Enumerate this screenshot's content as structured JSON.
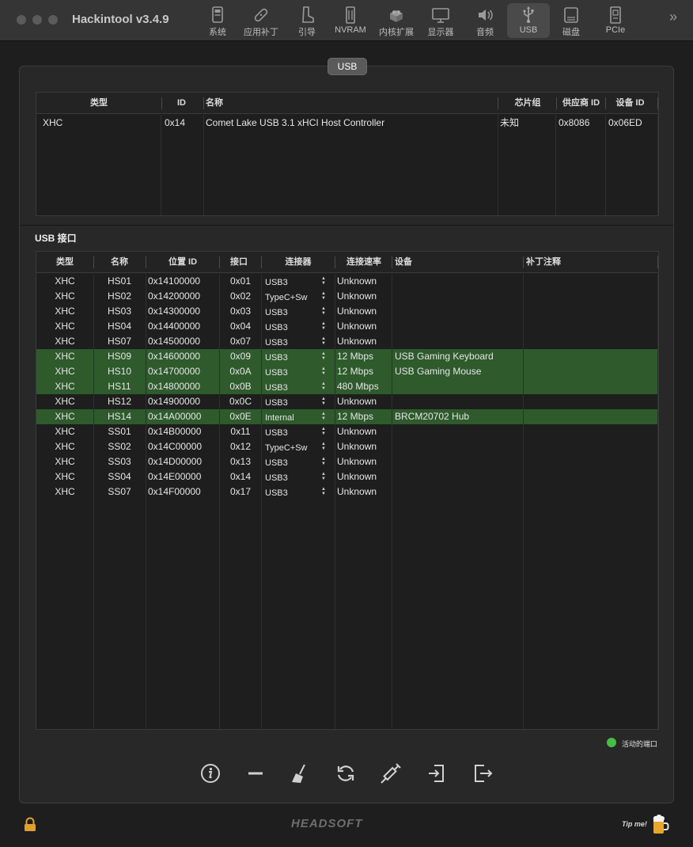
{
  "app": {
    "title": "Hackintool v3.4.9"
  },
  "toolbar": {
    "items": [
      {
        "label": "系统",
        "icon": "computer-icon"
      },
      {
        "label": "应用补丁",
        "icon": "bandage-icon"
      },
      {
        "label": "引导",
        "icon": "boot-icon"
      },
      {
        "label": "NVRAM",
        "icon": "memory-chip-icon"
      },
      {
        "label": "内核扩展",
        "icon": "lego-brick-icon"
      },
      {
        "label": "显示器",
        "icon": "monitor-icon"
      },
      {
        "label": "音频",
        "icon": "speaker-icon"
      },
      {
        "label": "USB",
        "icon": "usb-icon",
        "active": true
      },
      {
        "label": "磁盘",
        "icon": "disk-icon"
      },
      {
        "label": "PCIe",
        "icon": "pcie-card-icon"
      }
    ],
    "more": "»"
  },
  "panel": {
    "tab_label": "USB"
  },
  "controllers": {
    "headers": [
      "类型",
      "ID",
      "名称",
      "芯片组",
      "供应商 ID",
      "设备 ID"
    ],
    "rows": [
      [
        "XHC",
        "0x14",
        "Comet Lake USB 3.1 xHCI Host Controller",
        "未知",
        "0x8086",
        "0x06ED"
      ]
    ]
  },
  "ports": {
    "section_title": "USB 接口",
    "headers": [
      "类型",
      "名称",
      "位置 ID",
      "接口",
      "连接器",
      "连接速率",
      "设备",
      "补丁注释"
    ],
    "rows": [
      {
        "type": "XHC",
        "name": "HS01",
        "location": "0x14100000",
        "port": "0x01",
        "connector": "USB3",
        "speed": "Unknown",
        "device": "",
        "comment": "",
        "active": false
      },
      {
        "type": "XHC",
        "name": "HS02",
        "location": "0x14200000",
        "port": "0x02",
        "connector": "TypeC+Sw",
        "speed": "Unknown",
        "device": "",
        "comment": "",
        "active": false
      },
      {
        "type": "XHC",
        "name": "HS03",
        "location": "0x14300000",
        "port": "0x03",
        "connector": "USB3",
        "speed": "Unknown",
        "device": "",
        "comment": "",
        "active": false
      },
      {
        "type": "XHC",
        "name": "HS04",
        "location": "0x14400000",
        "port": "0x04",
        "connector": "USB3",
        "speed": "Unknown",
        "device": "",
        "comment": "",
        "active": false
      },
      {
        "type": "XHC",
        "name": "HS07",
        "location": "0x14500000",
        "port": "0x07",
        "connector": "USB3",
        "speed": "Unknown",
        "device": "",
        "comment": "",
        "active": false
      },
      {
        "type": "XHC",
        "name": "HS09",
        "location": "0x14600000",
        "port": "0x09",
        "connector": "USB3",
        "speed": "12 Mbps",
        "device": "USB Gaming Keyboard",
        "comment": "",
        "active": true
      },
      {
        "type": "XHC",
        "name": "HS10",
        "location": "0x14700000",
        "port": "0x0A",
        "connector": "USB3",
        "speed": "12 Mbps",
        "device": "USB Gaming Mouse",
        "comment": "",
        "active": true
      },
      {
        "type": "XHC",
        "name": "HS11",
        "location": "0x14800000",
        "port": "0x0B",
        "connector": "USB3",
        "speed": "480 Mbps",
        "device": "",
        "comment": "",
        "active": true
      },
      {
        "type": "XHC",
        "name": "HS12",
        "location": "0x14900000",
        "port": "0x0C",
        "connector": "USB3",
        "speed": "Unknown",
        "device": "",
        "comment": "",
        "active": false
      },
      {
        "type": "XHC",
        "name": "HS14",
        "location": "0x14A00000",
        "port": "0x0E",
        "connector": "Internal",
        "speed": "12 Mbps",
        "device": "BRCM20702 Hub",
        "comment": "",
        "active": true
      },
      {
        "type": "XHC",
        "name": "SS01",
        "location": "0x14B00000",
        "port": "0x11",
        "connector": "USB3",
        "speed": "Unknown",
        "device": "",
        "comment": "",
        "active": false
      },
      {
        "type": "XHC",
        "name": "SS02",
        "location": "0x14C00000",
        "port": "0x12",
        "connector": "TypeC+Sw",
        "speed": "Unknown",
        "device": "",
        "comment": "",
        "active": false
      },
      {
        "type": "XHC",
        "name": "SS03",
        "location": "0x14D00000",
        "port": "0x13",
        "connector": "USB3",
        "speed": "Unknown",
        "device": "",
        "comment": "",
        "active": false
      },
      {
        "type": "XHC",
        "name": "SS04",
        "location": "0x14E00000",
        "port": "0x14",
        "connector": "USB3",
        "speed": "Unknown",
        "device": "",
        "comment": "",
        "active": false
      },
      {
        "type": "XHC",
        "name": "SS07",
        "location": "0x14F00000",
        "port": "0x17",
        "connector": "USB3",
        "speed": "Unknown",
        "device": "",
        "comment": "",
        "active": false
      }
    ]
  },
  "legend": {
    "active_ports_label": "活动的端口",
    "active_color": "#43c043",
    "row_highlight": "#2e5a2c"
  },
  "actions": [
    {
      "name": "info-button",
      "icon": "info-icon"
    },
    {
      "name": "remove-button",
      "icon": "minus-icon"
    },
    {
      "name": "clear-button",
      "icon": "broom-icon"
    },
    {
      "name": "refresh-button",
      "icon": "refresh-icon"
    },
    {
      "name": "inject-button",
      "icon": "syringe-icon"
    },
    {
      "name": "import-button",
      "icon": "import-icon"
    },
    {
      "name": "export-button",
      "icon": "export-icon"
    }
  ],
  "footer": {
    "brand": "HEADSOFT",
    "tip": "Tip me!"
  }
}
